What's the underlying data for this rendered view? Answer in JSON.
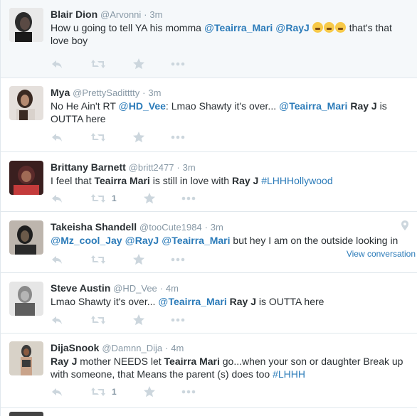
{
  "tweets": [
    {
      "fullname": "Blair Dion",
      "username": "@Arvonni",
      "sep": "·",
      "time": "3m",
      "text": [
        {
          "t": "How u going to tell YA his momma "
        },
        {
          "m": "@",
          "n": "Teairra_Mari"
        },
        {
          "t": " "
        },
        {
          "m": "@",
          "n": "RayJ"
        },
        {
          "t": " "
        },
        {
          "e": "weary-face-emoji"
        },
        {
          "e": "weary-face-emoji"
        },
        {
          "e": "weary-face-emoji"
        },
        {
          "t": " that's that love boy"
        }
      ],
      "retweets": "",
      "avatar_colors": [
        "#2b2b2b",
        "#5a4a44"
      ]
    },
    {
      "fullname": "Mya",
      "username": "@PrettySaditttty",
      "sep": "·",
      "time": "3m",
      "text": [
        {
          "t": "No He Ain't RT "
        },
        {
          "m": "@",
          "n": "HD_Vee"
        },
        {
          "t": ": Lmao Shawty it's over... "
        },
        {
          "m": "@",
          "n": "Teairra_Mari"
        },
        {
          "t": " "
        },
        {
          "b": "Ray J"
        },
        {
          "t": " is OUTTA here"
        }
      ],
      "retweets": "",
      "avatar_colors": [
        "#3a2a22",
        "#d9d2cc"
      ]
    },
    {
      "fullname": "Brittany Barnett",
      "username": "@britt2477",
      "sep": "·",
      "time": "3m",
      "text": [
        {
          "t": "I feel that "
        },
        {
          "b": "Teairra Mari"
        },
        {
          "t": " is still in love with "
        },
        {
          "b": "Ray J"
        },
        {
          "t": " "
        },
        {
          "h": "#LHHHollywood"
        }
      ],
      "retweets": "1",
      "avatar_colors": [
        "#5b2a2a",
        "#c43b3b"
      ]
    },
    {
      "fullname": "Takeisha Shandell",
      "username": "@tooCute1984",
      "sep": "·",
      "time": "3m",
      "text": [
        {
          "m": "@",
          "n": "Mz_cool_Jay"
        },
        {
          "t": " "
        },
        {
          "m": "@",
          "n": "RayJ"
        },
        {
          "t": " "
        },
        {
          "m": "@",
          "n": "Teairra_Mari"
        },
        {
          "t": " but hey I am on the outside looking in"
        }
      ],
      "retweets": "",
      "view_conversation": "View conversation",
      "avatar_colors": [
        "#1e1e1e",
        "#6b5a4a"
      ]
    },
    {
      "fullname": "Steve Austin",
      "username": "@HD_Vee",
      "sep": "·",
      "time": "4m",
      "text": [
        {
          "t": "Lmao Shawty it's over... "
        },
        {
          "m": "@",
          "n": "Teairra_Mari"
        },
        {
          "t": " "
        },
        {
          "b": "Ray J"
        },
        {
          "t": " is OUTTA here"
        }
      ],
      "retweets": "",
      "avatar_colors": [
        "#8a8a8a",
        "#e6e6e6"
      ]
    },
    {
      "fullname": "DijaSnook",
      "username": "@Damnn_Dija",
      "sep": "·",
      "time": "4m",
      "text": [
        {
          "b": "Ray J"
        },
        {
          "t": " mother NEEDS let "
        },
        {
          "b": "Teairra Mari"
        },
        {
          "t": " go...when your son or daughter Break up with someone, that Means the parent (s) does too "
        },
        {
          "h": "#LHHH"
        }
      ],
      "retweets": "1",
      "avatar_colors": [
        "#3a3a3a",
        "#c9a38a"
      ]
    }
  ],
  "colors": {
    "link": "#2b7bb9",
    "muted": "#8899a6",
    "icon": "#ccd6dd",
    "highlight_bg": "#f5f8fa",
    "divider": "#e1e8ed"
  }
}
